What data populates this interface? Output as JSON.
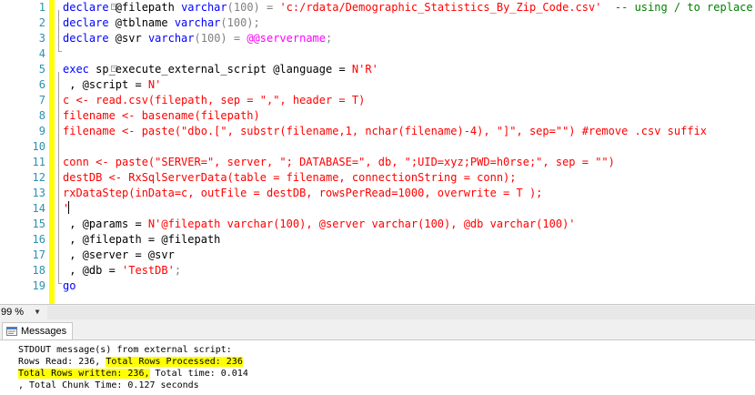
{
  "editor": {
    "line_numbers": [
      "1",
      "2",
      "3",
      "4",
      "5",
      "6",
      "7",
      "8",
      "9",
      "10",
      "11",
      "12",
      "13",
      "14",
      "15",
      "16",
      "17",
      "18",
      "19"
    ],
    "lines": [
      [
        [
          "declare",
          "kw"
        ],
        [
          " @filepath ",
          ""
        ],
        [
          "varchar",
          "kw"
        ],
        [
          "(100) = ",
          "gr"
        ],
        [
          "'c:/rdata/Demographic_Statistics_By_Zip_Code.csv'",
          "str"
        ],
        [
          "  -- using / to replace \\",
          "cm"
        ]
      ],
      [
        [
          "declare",
          "kw"
        ],
        [
          " @tblname ",
          ""
        ],
        [
          "varchar",
          "kw"
        ],
        [
          "(100);",
          "gr"
        ]
      ],
      [
        [
          "declare",
          "kw"
        ],
        [
          " @svr ",
          ""
        ],
        [
          "varchar",
          "kw"
        ],
        [
          "(100) = ",
          "gr"
        ],
        [
          "@@servername",
          "sv"
        ],
        [
          ";",
          "gr"
        ]
      ],
      [],
      [
        [
          "exec",
          "kw"
        ],
        [
          " sp_execute_external_script @language = ",
          ""
        ],
        [
          "N'R'",
          "str"
        ]
      ],
      [
        [
          " , @script = ",
          ""
        ],
        [
          "N'",
          "str"
        ]
      ],
      [
        [
          "c <- read.csv(filepath, sep = \",\", header = T)",
          "str"
        ]
      ],
      [
        [
          "filename <- basename(filepath)",
          "str"
        ]
      ],
      [
        [
          "filename <- paste(\"dbo.[\", substr(filename,1, nchar(filename)-4), \"]\", sep=\"\") #remove .csv suffix",
          "str"
        ]
      ],
      [],
      [
        [
          "conn <- paste(\"SERVER=\", server, \"; DATABASE=\", db, \";UID=xyz;PWD=h0rse;\", sep = \"\")",
          "str"
        ]
      ],
      [
        [
          "destDB <- RxSqlServerData(table = filename, connectionString = conn);",
          "str"
        ]
      ],
      [
        [
          "rxDataStep(inData=c, outFile = destDB, rowsPerRead=1000, overwrite = T );",
          "str"
        ]
      ],
      [
        [
          "'",
          "str"
        ]
      ],
      [
        [
          " , @params = ",
          ""
        ],
        [
          "N'@filepath varchar(100), @server varchar(100), @db varchar(100)'",
          "str"
        ]
      ],
      [
        [
          " , @filepath = @filepath",
          ""
        ]
      ],
      [
        [
          " , @server = @svr",
          ""
        ]
      ],
      [
        [
          " , @db = ",
          ""
        ],
        [
          "'TestDB'",
          "str"
        ],
        [
          ";",
          "gr"
        ]
      ],
      [
        [
          "go",
          "kw"
        ]
      ]
    ]
  },
  "status": {
    "zoom": "99 %"
  },
  "messages": {
    "tab_label": "Messages",
    "lines": [
      [
        [
          "STDOUT message(s) from external script:",
          ""
        ]
      ],
      [
        [
          "Rows Read: 236, ",
          ""
        ],
        [
          "Total Rows Processed: 236",
          "hl"
        ]
      ],
      [
        [
          "Total Rows written: 236,",
          "hl"
        ],
        [
          " Total time: 0.014",
          ""
        ]
      ],
      [
        [
          ", Total Chunk Time: 0.127 seconds",
          ""
        ]
      ]
    ]
  },
  "colors": {
    "keyword": "#0000ff",
    "string": "#ff0000",
    "comment": "#008000",
    "system_variable": "#ff00ff",
    "line_number": "#2b91af",
    "highlight": "#ffff00"
  }
}
